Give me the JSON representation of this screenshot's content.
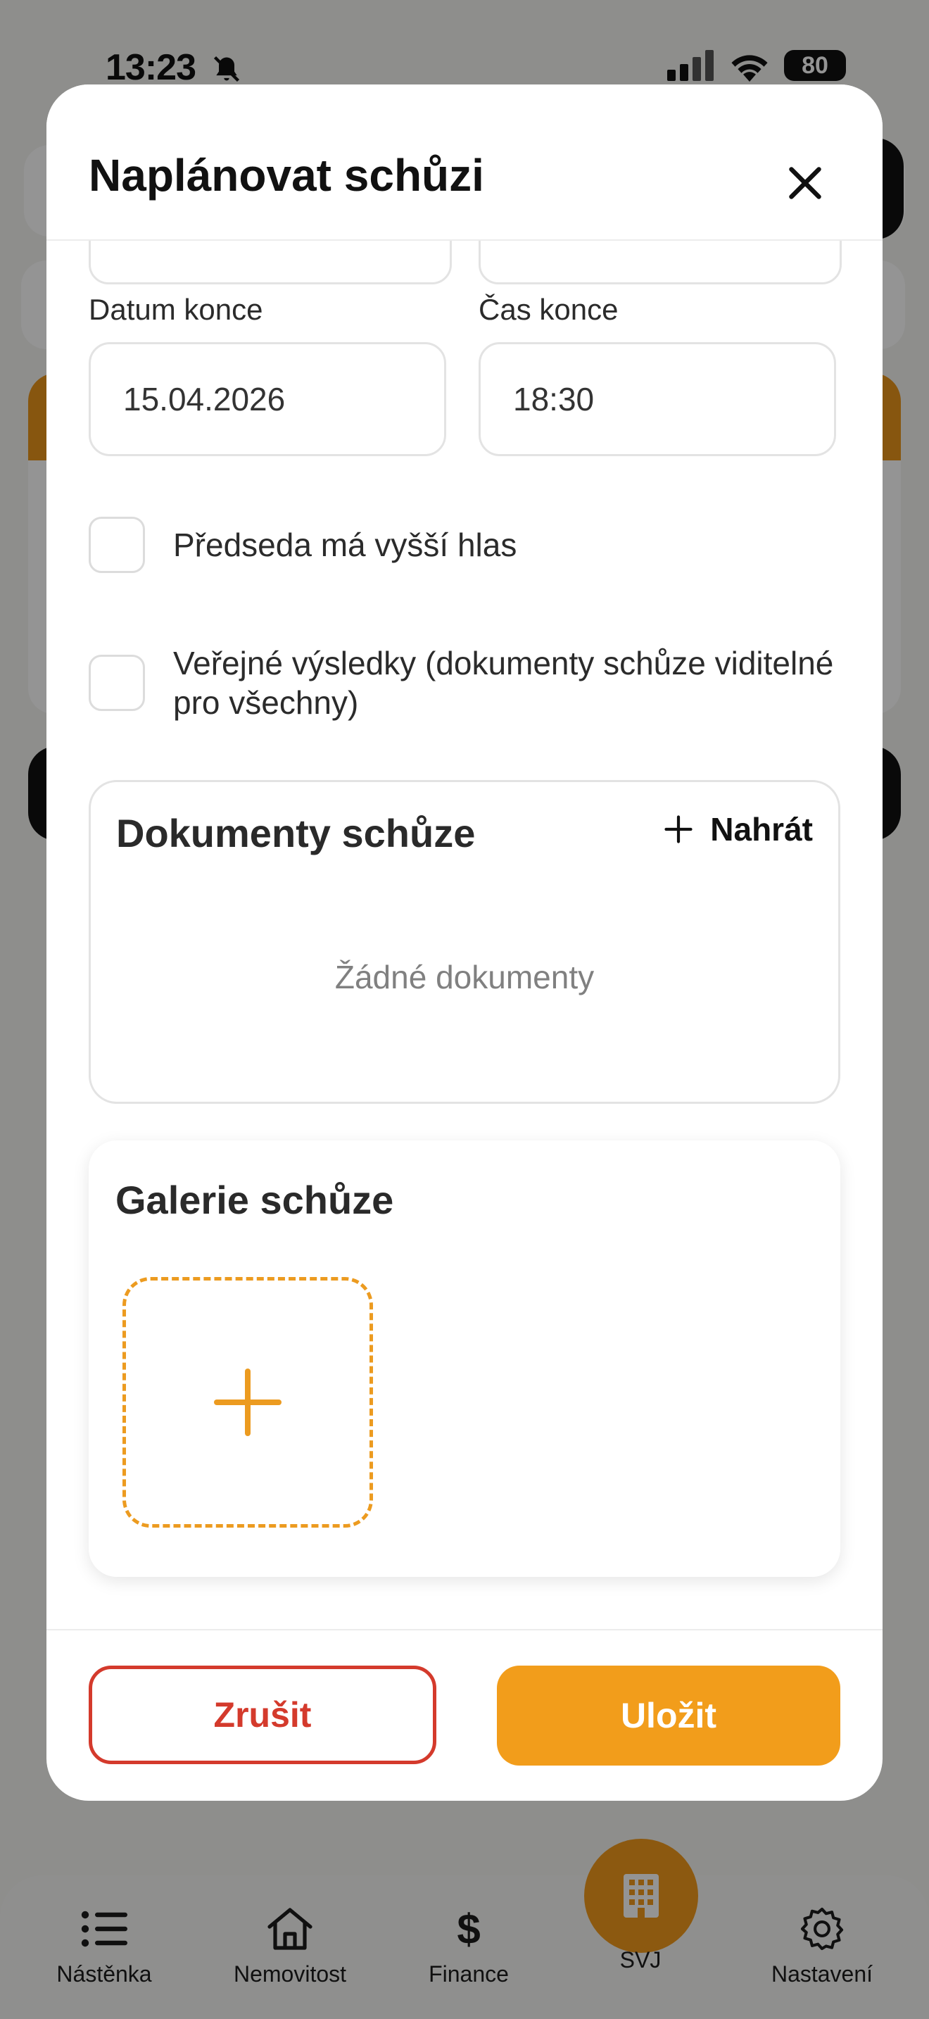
{
  "status_bar": {
    "time": "13:23",
    "battery": "80"
  },
  "modal": {
    "title": "Naplánovat schůzi",
    "end_date": {
      "label": "Datum konce",
      "value": "15.04.2026"
    },
    "end_time": {
      "label": "Čas konce",
      "value": "18:30"
    },
    "chair_checkbox": {
      "label": "Předseda má vyšší hlas",
      "checked": false
    },
    "public_checkbox": {
      "label_line1": "Veřejné výsledky (dokumenty schůze viditelné",
      "label_line2": "pro všechny)",
      "checked": false
    },
    "documents": {
      "title": "Dokumenty schůze",
      "upload_label": "Nahrát",
      "empty_text": "Žádné dokumenty"
    },
    "gallery": {
      "title": "Galerie schůze"
    },
    "cancel_label": "Zrušit",
    "save_label": "Uložit"
  },
  "tabbar": {
    "items": [
      {
        "label": "Nástěnka",
        "icon": "list-icon"
      },
      {
        "label": "Nemovitost",
        "icon": "house-icon"
      },
      {
        "label": "Finance",
        "icon": "dollar-icon"
      },
      {
        "label": "SVJ",
        "icon": "building-icon"
      },
      {
        "label": "Nastavení",
        "icon": "gear-icon"
      }
    ]
  },
  "colors": {
    "accent": "#f29d1b",
    "danger": "#d43a2c"
  }
}
